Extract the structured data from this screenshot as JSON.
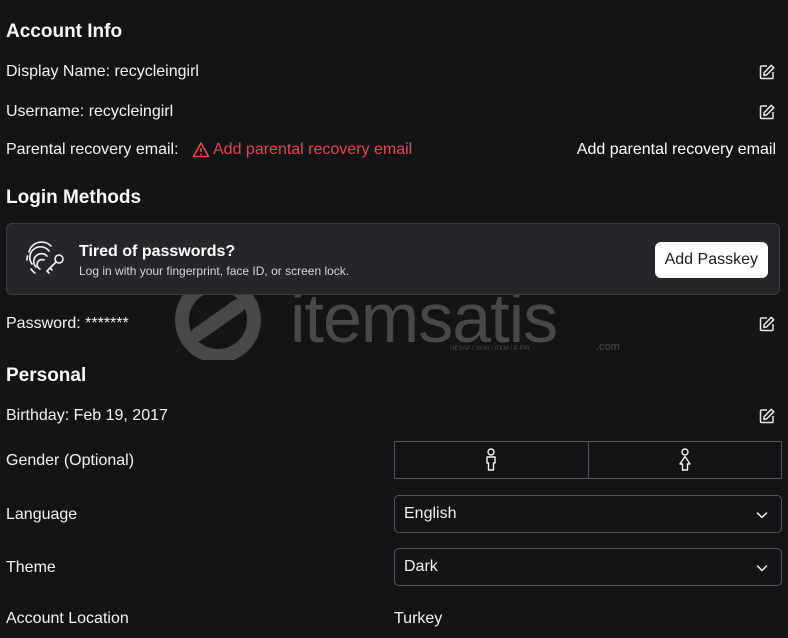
{
  "account_info": {
    "heading": "Account Info",
    "display_name": "Display Name: recycleingirl",
    "username": "Username: recycleingirl",
    "parental_label": "Parental recovery email:",
    "parental_warning": "Add parental recovery email",
    "parental_action": "Add parental recovery email"
  },
  "login_methods": {
    "heading": "Login Methods",
    "passkey_title": "Tired of passwords?",
    "passkey_subtitle": "Log in with your fingerprint, face ID, or screen lock.",
    "passkey_button": "Add Passkey",
    "password": "Password: *******"
  },
  "personal": {
    "heading": "Personal",
    "birthday": "Birthday: Feb 19, 2017",
    "gender_label": "Gender (Optional)",
    "language_label": "Language",
    "language_value": "English",
    "theme_label": "Theme",
    "theme_value": "Dark",
    "location_label": "Account Location",
    "location_value": "Turkey"
  },
  "watermark": {
    "brand": "itemsatis",
    "tagline": "HESAP / SKIN / ITEM / E-PIN",
    "suffix": ".com"
  },
  "colors": {
    "background": "#131416",
    "warning": "#e5484d",
    "card": "#24262b",
    "border": "#55575d"
  },
  "icons": {
    "edit": "edit-icon",
    "warning": "warning-triangle-icon",
    "passkey": "fingerprint-key-icon",
    "gender_male": "male-icon",
    "gender_female": "female-icon",
    "chevron": "chevron-down-icon"
  }
}
